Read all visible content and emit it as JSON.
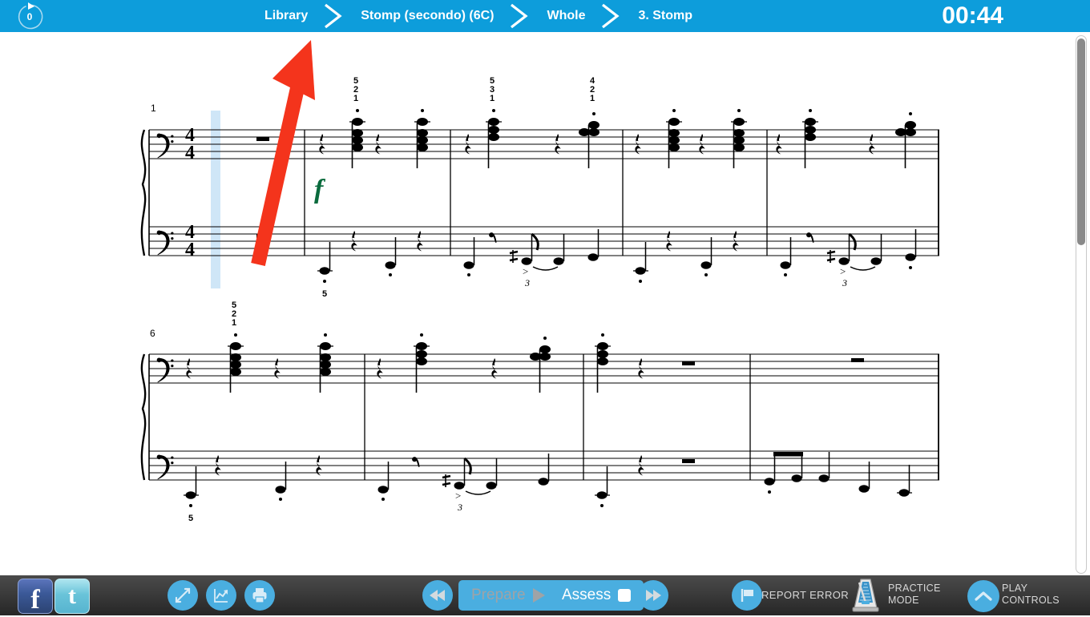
{
  "header": {
    "replay_count": "0",
    "replay_icon": "circular-replay-icon",
    "breadcrumb": [
      {
        "label": "Library"
      },
      {
        "label": "Stomp (secondo) (6C)"
      },
      {
        "label": "Whole"
      },
      {
        "label": "3. Stomp"
      }
    ],
    "session_timer": "00:44",
    "background_color": "#0d9ddb"
  },
  "score": {
    "title_visible": false,
    "systems": [
      {
        "start_measure_number": "1",
        "clef_top": "bass",
        "clef_bottom": "bass",
        "time_signature": "4/4",
        "dynamic": "f",
        "dynamic_color": "#0a6b3d",
        "fingerings_top": [
          "5 2 1",
          "5 3 1",
          "4 2 1"
        ],
        "fingerings_bottom": [
          "5"
        ],
        "tuplets": [
          "3",
          "3"
        ],
        "measures": 5
      },
      {
        "start_measure_number": "6",
        "clef_top": "bass",
        "clef_bottom": "bass",
        "fingerings_top": [
          "5 2 1"
        ],
        "fingerings_bottom": [
          "5"
        ],
        "tuplets": [
          "3"
        ],
        "measures": 4
      }
    ],
    "playhead_highlight_color": "#cfe6f7",
    "annotation_arrow": {
      "color": "#f4341c",
      "from": "320,330",
      "to": "385,50",
      "direction": "up-right"
    }
  },
  "scrollbar": {
    "orientation": "vertical",
    "thumb_position_percent": "0"
  },
  "bottom_bar": {
    "social": [
      {
        "name": "facebook",
        "glyph": "f"
      },
      {
        "name": "twitter",
        "glyph": "t"
      }
    ],
    "tools": [
      {
        "name": "fullscreen",
        "icon": "expand-arrows-icon"
      },
      {
        "name": "progress",
        "icon": "line-chart-icon"
      },
      {
        "name": "print",
        "icon": "printer-icon"
      }
    ],
    "transport": {
      "rewind_icon": "rewind-icon",
      "prepare_label": "Prepare",
      "prepare_icon": "play-triangle-icon",
      "prepare_enabled": false,
      "assess_label": "Assess",
      "assess_icon": "stop-square-icon",
      "assess_enabled": true,
      "forward_icon": "fast-forward-icon"
    },
    "report_error_label": "REPORT ERROR",
    "report_error_icon": "flag-icon",
    "practice_mode_label_line1": "PRACTICE",
    "practice_mode_label_line2": "MODE",
    "practice_mode_icon": "metronome-icon",
    "play_controls_label_line1": "PLAY",
    "play_controls_label_line2": "CONTROLS",
    "play_controls_icon": "chevron-up-icon",
    "accent_color": "#4aaee0"
  }
}
